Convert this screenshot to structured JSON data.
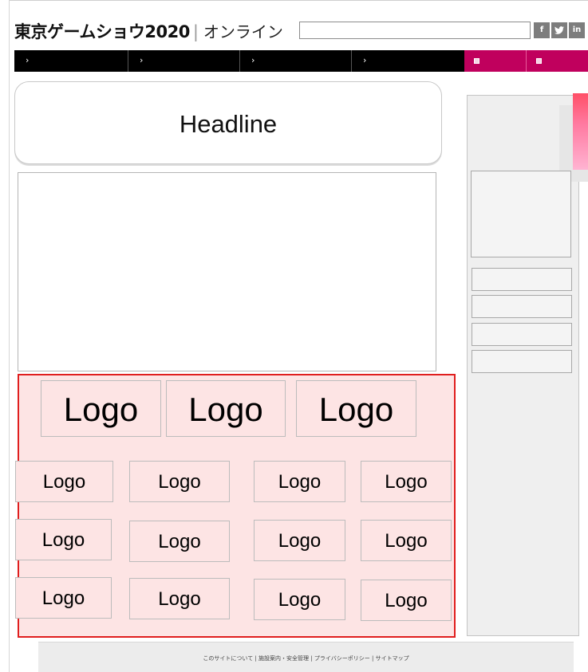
{
  "header": {
    "brand": "東京ゲームショウ2020",
    "separator": "|",
    "subtitle": "オンライン",
    "social": [
      {
        "icon": "facebook-icon",
        "glyph": "f"
      },
      {
        "icon": "twitter-icon",
        "glyph": "🐦"
      },
      {
        "icon": "linkedin-icon",
        "glyph": "in"
      }
    ]
  },
  "nav": {
    "items": [
      {
        "label": "›"
      },
      {
        "label": "›"
      },
      {
        "label": "›"
      },
      {
        "label": "›"
      }
    ],
    "accent_items": 2,
    "accent_color": "#c0005d"
  },
  "headline": "Headline",
  "logos": {
    "row1": [
      "Logo",
      "Logo",
      "Logo"
    ],
    "grid": [
      [
        "Logo",
        "Logo",
        "Logo",
        "Logo"
      ],
      [
        "Logo",
        "Logo",
        "Logo",
        "Logo"
      ],
      [
        "Logo",
        "Logo",
        "Logo",
        "Logo"
      ]
    ],
    "highlight_border": "#e01e1e",
    "highlight_fill": "#fde4e4"
  },
  "footer": {
    "links": [
      "このサイトについて",
      "施設案内・安全管理",
      "プライバシーポリシー",
      "サイトマップ"
    ],
    "separator": "|"
  }
}
